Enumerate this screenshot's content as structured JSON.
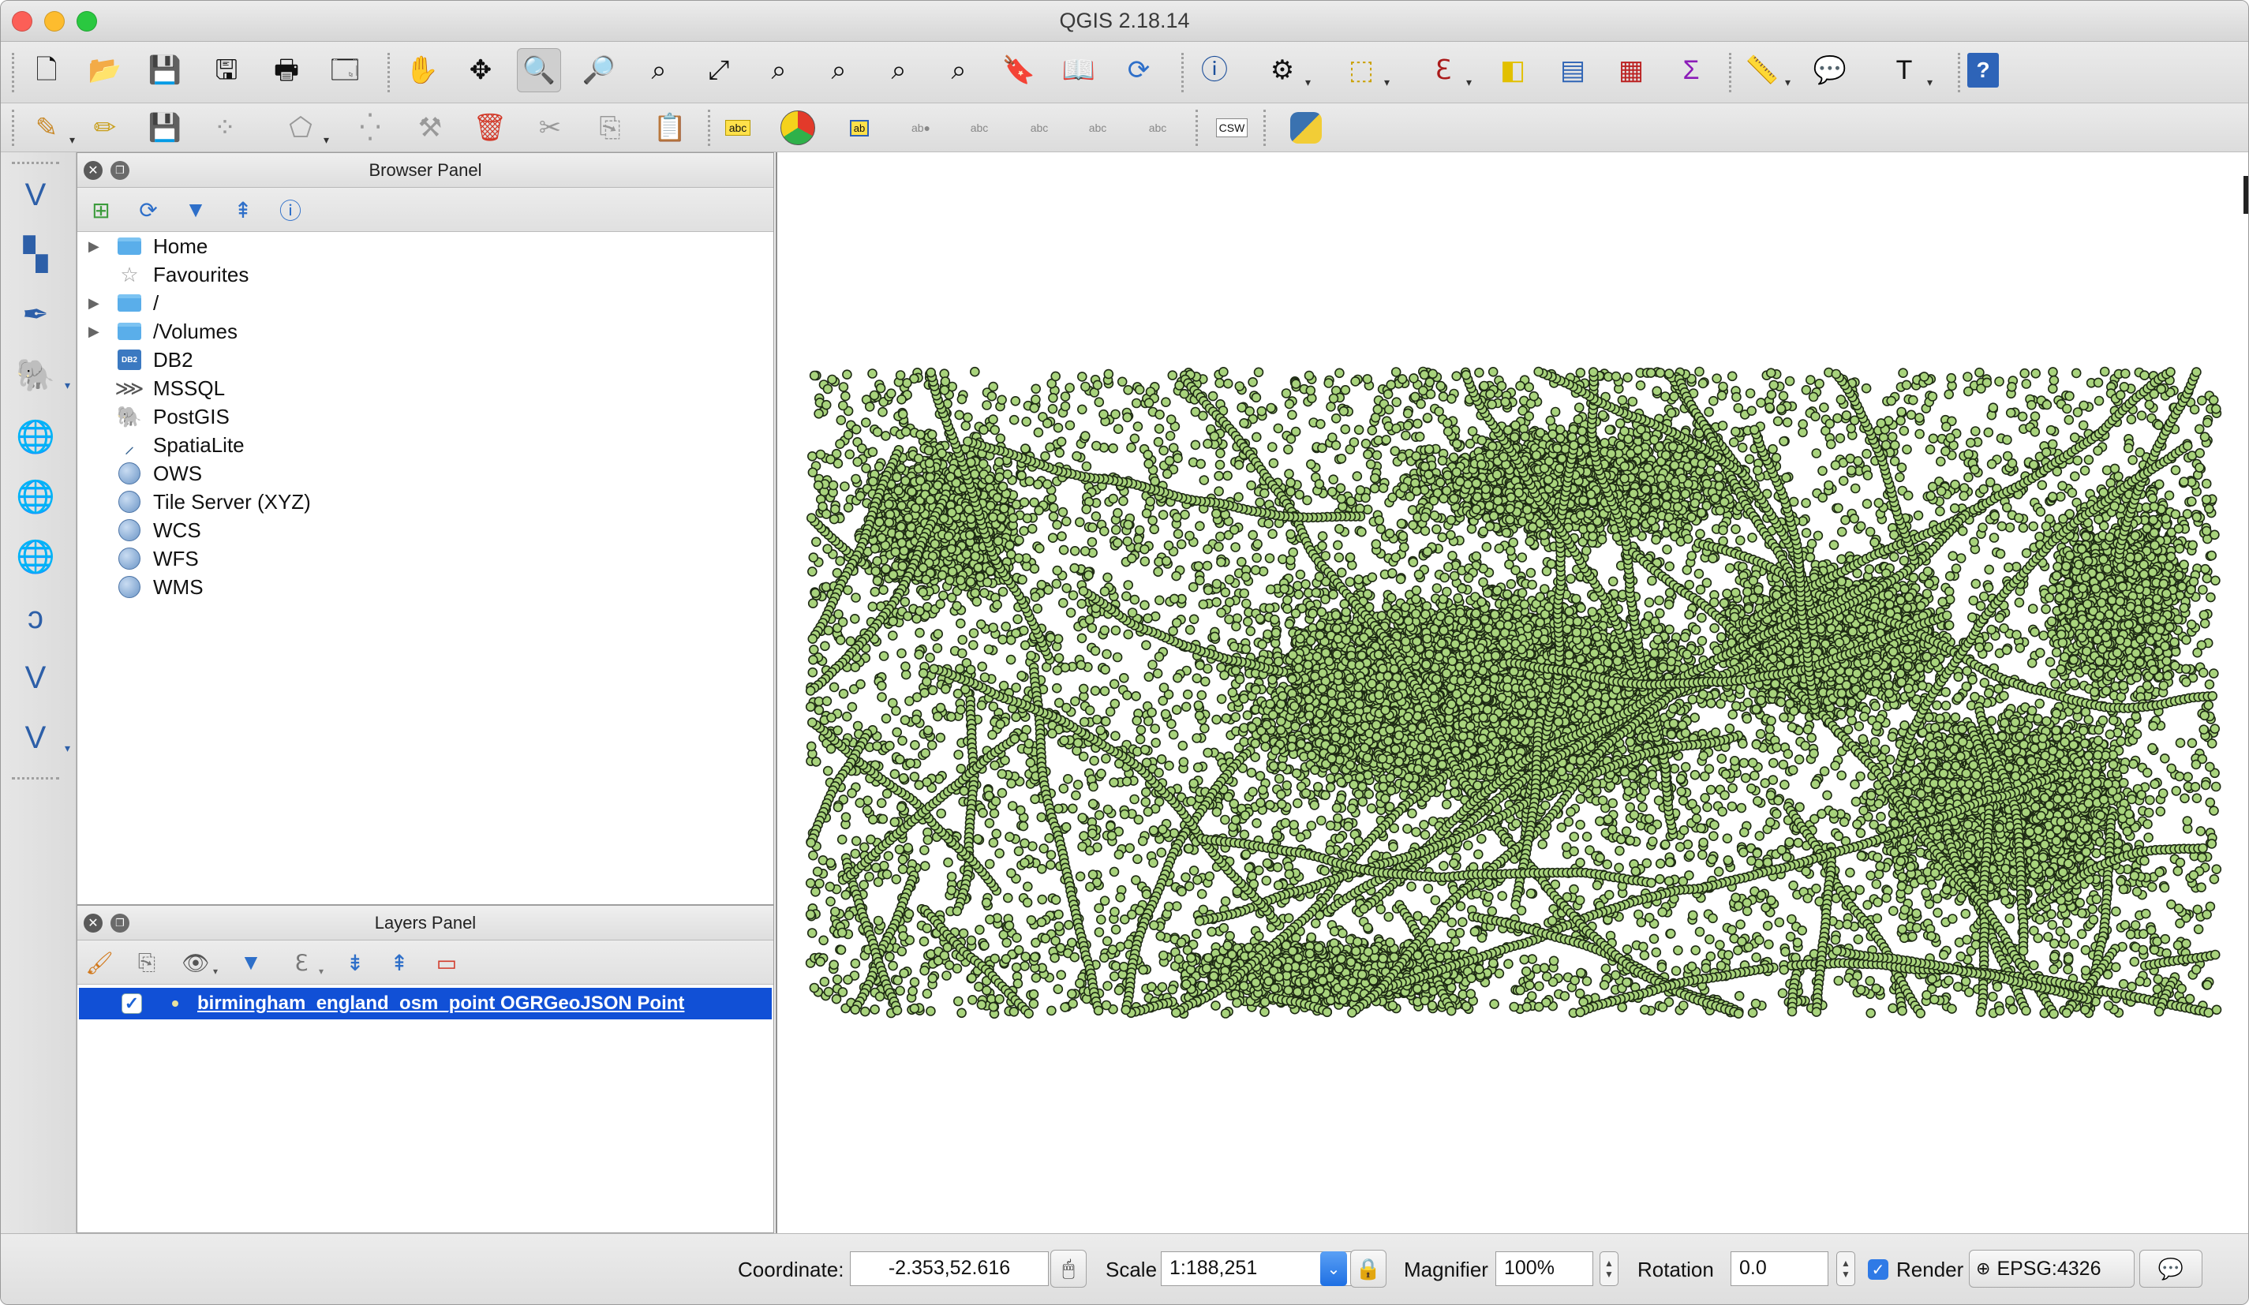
{
  "window": {
    "title": "QGIS 2.18.14"
  },
  "colors": {
    "point_fill": "#a8d37c",
    "point_stroke": "#1e2a14",
    "selection_blue": "#1150d6",
    "accent_blue": "#2f7ae6"
  },
  "toolbar_main": [
    "new-project-icon",
    "open-project-icon",
    "save-project-icon",
    "save-as-icon",
    "new-print-composer-icon",
    "composer-manager-icon",
    "pan-icon",
    "pan-to-selection-icon",
    "zoom-in-icon",
    "zoom-out-icon",
    "zoom-native-icon",
    "zoom-full-icon",
    "zoom-to-selection-icon",
    "zoom-to-layer-icon",
    "zoom-last-icon",
    "zoom-next-icon",
    "new-bookmark-icon",
    "show-bookmarks-icon",
    "refresh-icon",
    "identify-icon",
    "action-icon",
    "select-features-icon",
    "select-by-expression-icon",
    "deselect-icon",
    "attribute-table-icon",
    "field-calculator-icon",
    "statistics-icon",
    "measure-icon",
    "map-tips-icon",
    "text-annotation-icon",
    "help-icon"
  ],
  "toolbar_edit": [
    "current-edits-icon",
    "toggle-editing-icon",
    "save-edits-icon",
    "add-feature-icon",
    "vertex-tool-icon",
    "move-feature-icon",
    "node-tool-icon",
    "delete-selected-icon",
    "cut-features-icon",
    "copy-features-icon",
    "paste-features-icon",
    "label-tool-icon",
    "diagram-icon",
    "pin-labels-icon",
    "highlight-pinned-icon",
    "show-hide-labels-icon",
    "move-label-icon",
    "rotate-label-icon",
    "change-label-icon",
    "csw-icon",
    "python-icon"
  ],
  "toolbar_edit_csw_text": "CSW",
  "left_toolbar": [
    "add-vector-layer-icon",
    "add-raster-layer-icon",
    "add-delimited-text-icon",
    "add-postgis-layer-icon",
    "add-spatialite-layer-icon",
    "add-wms-layer-icon",
    "add-wcs-layer-icon",
    "add-wfs-layer-icon",
    "new-shapefile-icon",
    "add-virtual-layer-icon",
    "new-layer-icon"
  ],
  "browser_panel": {
    "title": "Browser Panel",
    "items": [
      {
        "label": "Home",
        "icon": "folder-icon",
        "expandable": true
      },
      {
        "label": "Favourites",
        "icon": "star-icon",
        "expandable": false
      },
      {
        "label": "/",
        "icon": "folder-icon",
        "expandable": true
      },
      {
        "label": "/Volumes",
        "icon": "folder-icon",
        "expandable": true
      },
      {
        "label": "DB2",
        "icon": "db2-icon",
        "expandable": false
      },
      {
        "label": "MSSQL",
        "icon": "mssql-icon",
        "expandable": false
      },
      {
        "label": "PostGIS",
        "icon": "postgis-icon",
        "expandable": false
      },
      {
        "label": "SpatiaLite",
        "icon": "spatialite-icon",
        "expandable": false
      },
      {
        "label": "OWS",
        "icon": "globe-icon",
        "expandable": false
      },
      {
        "label": "Tile Server (XYZ)",
        "icon": "globe-icon",
        "expandable": false
      },
      {
        "label": "WCS",
        "icon": "globe-icon",
        "expandable": false
      },
      {
        "label": "WFS",
        "icon": "globe-icon",
        "expandable": false
      },
      {
        "label": "WMS",
        "icon": "globe-icon",
        "expandable": false
      }
    ],
    "db2_badge": "DB2"
  },
  "layers_panel": {
    "title": "Layers Panel",
    "layers": [
      {
        "label": "birmingham_england_osm_point OGRGeoJSON Point",
        "checked": true
      }
    ]
  },
  "statusbar": {
    "coordinate_label": "Coordinate:",
    "coordinate_value": "-2.353,52.616",
    "scale_label": "Scale",
    "scale_value": "1:188,251",
    "magnifier_label": "Magnifier",
    "magnifier_value": "100%",
    "rotation_label": "Rotation",
    "rotation_value": "0.0",
    "render_label": "Render",
    "render_checked": true,
    "crs_label": "EPSG:4326"
  }
}
